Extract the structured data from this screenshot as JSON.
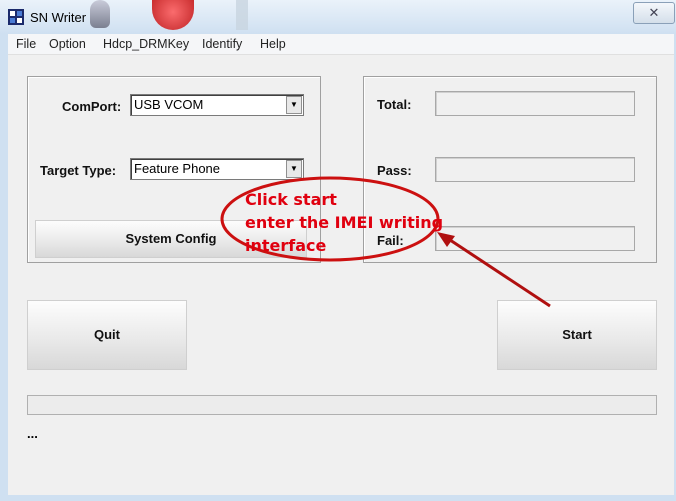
{
  "window": {
    "title": "SN Writer",
    "close_glyph": "✕"
  },
  "menu": [
    {
      "label": "File"
    },
    {
      "label": "Option"
    },
    {
      "label": "Hdcp_DRMKey"
    },
    {
      "label": "Identify"
    },
    {
      "label": "Help"
    }
  ],
  "settings": {
    "comport_label": "ComPort:",
    "comport_value": "USB VCOM",
    "target_label": "Target Type:",
    "target_value": "Feature Phone",
    "system_config_label": "System Config"
  },
  "stats": {
    "total_label": "Total:",
    "pass_label": "Pass:",
    "fail_label": "Fail:"
  },
  "buttons": {
    "quit_label": "Quit",
    "start_label": "Start"
  },
  "status": {
    "text": "..."
  },
  "annotation": {
    "line1": "Click start",
    "line2": "enter the IMEI writing",
    "line3": "interface",
    "color": "#e0000f"
  },
  "icons": [
    "app-icon",
    "close-icon",
    "dropdown-arrow-icon"
  ]
}
